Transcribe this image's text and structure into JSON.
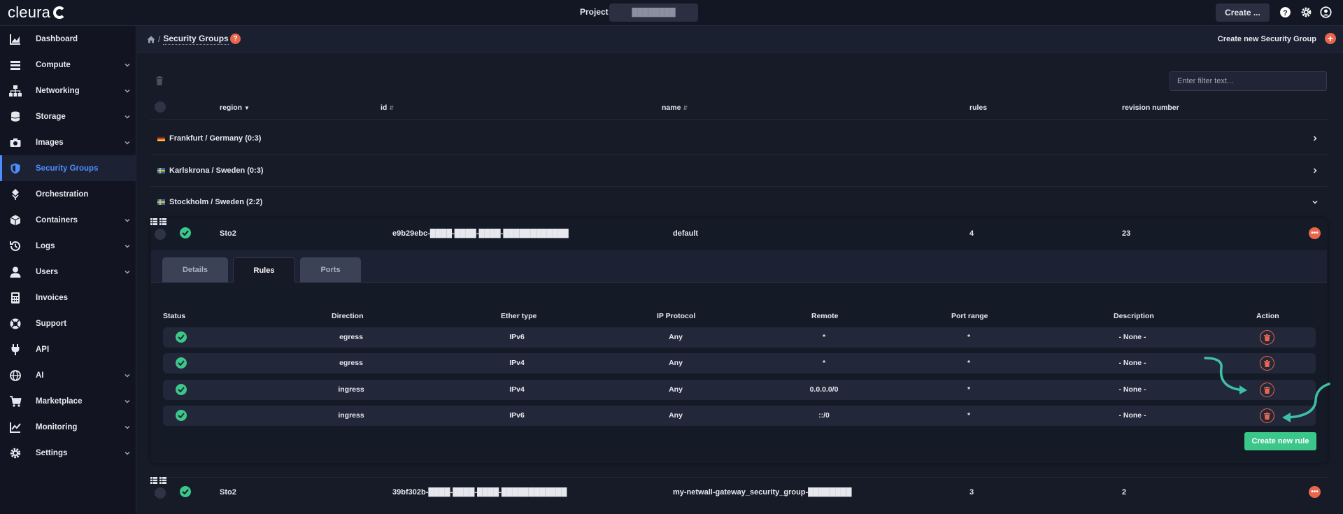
{
  "topbar": {
    "brand": "cleura",
    "project_label": "Project",
    "project_value": "████████",
    "create_label": "Create ..."
  },
  "sidebar": {
    "items": [
      {
        "label": "Dashboard",
        "icon": "chart-icon",
        "expandable": false,
        "active": false
      },
      {
        "label": "Compute",
        "icon": "server-icon",
        "expandable": true,
        "active": false
      },
      {
        "label": "Networking",
        "icon": "network-icon",
        "expandable": true,
        "active": false
      },
      {
        "label": "Storage",
        "icon": "database-icon",
        "expandable": true,
        "active": false
      },
      {
        "label": "Images",
        "icon": "camera-icon",
        "expandable": true,
        "active": false
      },
      {
        "label": "Security Groups",
        "icon": "shield-icon",
        "expandable": false,
        "active": true
      },
      {
        "label": "Orchestration",
        "icon": "orchestration-icon",
        "expandable": false,
        "active": false
      },
      {
        "label": "Containers",
        "icon": "cube-icon",
        "expandable": true,
        "active": false
      },
      {
        "label": "Logs",
        "icon": "history-icon",
        "expandable": true,
        "active": false
      },
      {
        "label": "Users",
        "icon": "user-icon",
        "expandable": true,
        "active": false
      },
      {
        "label": "Invoices",
        "icon": "calculator-icon",
        "expandable": false,
        "active": false
      },
      {
        "label": "Support",
        "icon": "lifebuoy-icon",
        "expandable": false,
        "active": false
      },
      {
        "label": "API",
        "icon": "plug-icon",
        "expandable": false,
        "active": false
      },
      {
        "label": "AI",
        "icon": "ai-icon",
        "expandable": true,
        "active": false
      },
      {
        "label": "Marketplace",
        "icon": "cart-icon",
        "expandable": true,
        "active": false
      },
      {
        "label": "Monitoring",
        "icon": "monitoring-icon",
        "expandable": true,
        "active": false
      },
      {
        "label": "Settings",
        "icon": "gear-icon",
        "expandable": true,
        "active": false
      }
    ]
  },
  "header": {
    "breadcrumb_sep": "/",
    "title": "Security Groups",
    "help": "?",
    "create_new": "Create new Security Group",
    "plus": "+"
  },
  "filter": {
    "placeholder": "Enter filter text..."
  },
  "table": {
    "columns": {
      "region": "region",
      "id": "id",
      "name": "name",
      "rules": "rules",
      "revision": "revision number"
    },
    "groups": [
      {
        "label": "Frankfurt / Germany (0:3)",
        "flag": "de"
      },
      {
        "label": "Karlskrona / Sweden (0:3)",
        "flag": "se"
      },
      {
        "label": "Stockholm / Sweden (2:2)",
        "flag": "se"
      }
    ],
    "rows": [
      {
        "region": "Sto2",
        "id": "e9b29ebc-████-████-████-████████████",
        "name": "default",
        "rules": "4",
        "revision": "23"
      },
      {
        "region": "Sto2",
        "id": "39bf302b-████-████-████-████████████",
        "name": "my-netwall-gateway_security_group-████████",
        "rules": "3",
        "revision": "2"
      }
    ]
  },
  "detail": {
    "tabs": [
      "Details",
      "Rules",
      "Ports"
    ],
    "active_tab": "Rules",
    "rule_columns": {
      "status": "Status",
      "direction": "Direction",
      "ether": "Ether type",
      "protocol": "IP Protocol",
      "remote": "Remote",
      "port": "Port range",
      "description": "Description",
      "action": "Action"
    },
    "rules": [
      {
        "direction": "egress",
        "ether": "IPv6",
        "protocol": "Any",
        "remote": "*",
        "port": "*",
        "description": "- None -"
      },
      {
        "direction": "egress",
        "ether": "IPv4",
        "protocol": "Any",
        "remote": "*",
        "port": "*",
        "description": "- None -"
      },
      {
        "direction": "ingress",
        "ether": "IPv4",
        "protocol": "Any",
        "remote": "0.0.0.0/0",
        "port": "*",
        "description": "- None -"
      },
      {
        "direction": "ingress",
        "ether": "IPv6",
        "protocol": "Any",
        "remote": "::/0",
        "port": "*",
        "description": "- None -"
      }
    ],
    "create_rule": "Create new rule"
  },
  "colors": {
    "accent": "#4d8dff",
    "danger": "#e8674c",
    "success": "#3bc78a",
    "annotation": "#3fbfa8"
  }
}
